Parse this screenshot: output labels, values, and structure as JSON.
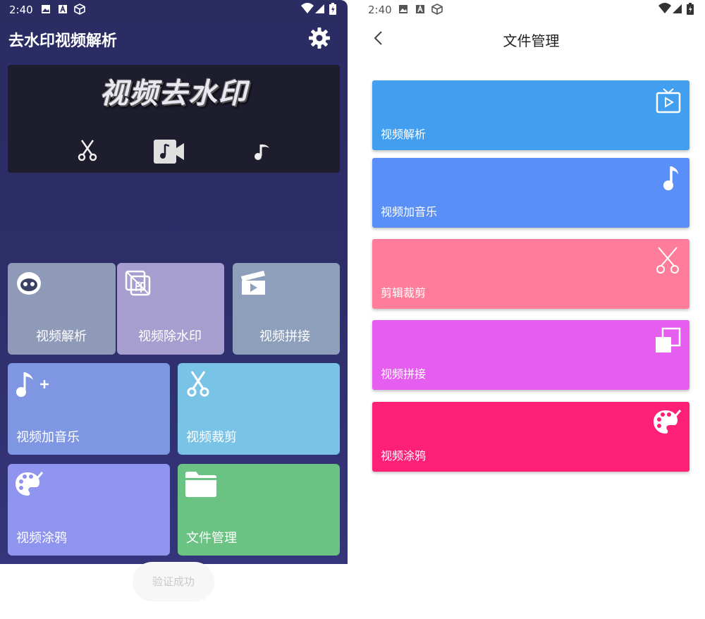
{
  "left": {
    "status_time": "2:40",
    "app_title": "去水印视频解析",
    "banner_title": "视频去水印",
    "toast": "验证成功",
    "tiles": [
      {
        "label": "视频解析",
        "color": "#8f9ab8"
      },
      {
        "label": "视频除水印",
        "color": "#a79ed0"
      },
      {
        "label": "视频拼接",
        "color": "#8e9fbb"
      },
      {
        "label": "视频加音乐",
        "color": "#7f97e2"
      },
      {
        "label": "视频裁剪",
        "color": "#79c3e6"
      },
      {
        "label": "视频涂鸦",
        "color": "#8f94ee"
      },
      {
        "label": "文件管理",
        "color": "#6ac283"
      }
    ]
  },
  "right": {
    "status_time": "2:40",
    "title": "文件管理",
    "cards": [
      {
        "label": "视频解析",
        "color": "#429ff0",
        "icon": "tv-play-icon"
      },
      {
        "label": "视频加音乐",
        "color": "#5b8ff8",
        "icon": "music-note-icon"
      },
      {
        "label": "剪辑裁剪",
        "color": "#ff7d9a",
        "icon": "scissors-icon"
      },
      {
        "label": "视频拼接",
        "color": "#e65ef0",
        "icon": "overlap-squares-icon"
      },
      {
        "label": "视频涂鸦",
        "color": "#fe1f77",
        "icon": "palette-icon"
      }
    ]
  }
}
